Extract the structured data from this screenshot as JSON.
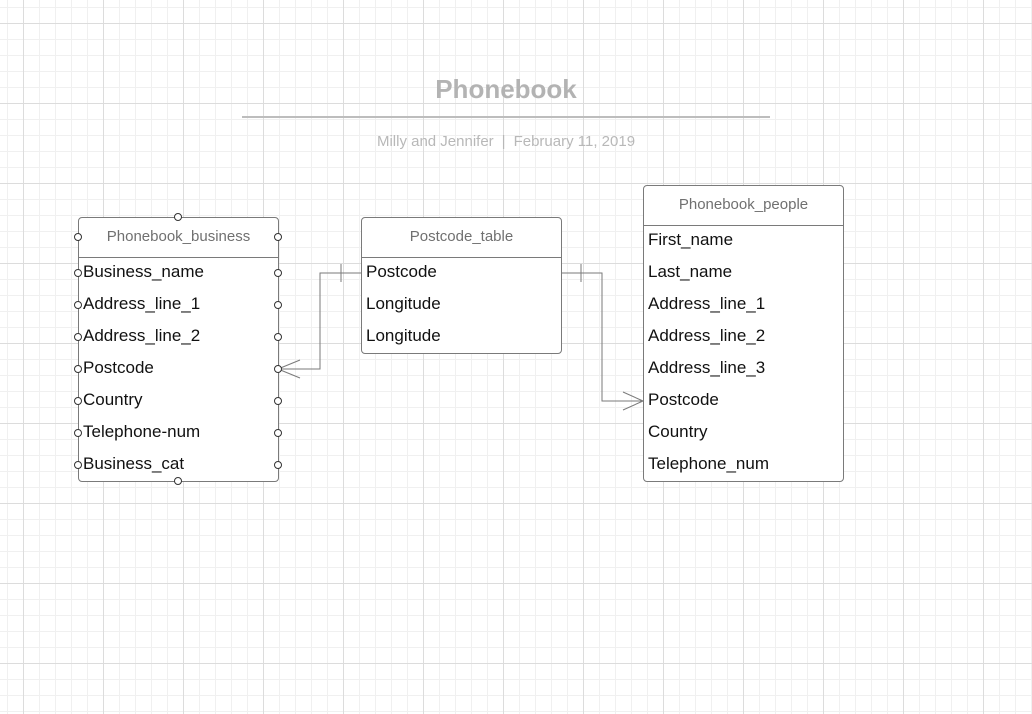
{
  "header": {
    "title": "Phonebook",
    "authors": "Milly and Jennifer",
    "separator": "|",
    "date": "February 11, 2019"
  },
  "entities": {
    "business": {
      "name": "Phonebook_business",
      "fields": [
        "Business_name",
        "Address_line_1",
        "Address_line_2",
        "Postcode",
        "Country",
        "Telephone-num",
        "Business_cat"
      ]
    },
    "postcode": {
      "name": "Postcode_table",
      "fields": [
        "Postcode",
        "Longitude",
        "Longitude"
      ]
    },
    "people": {
      "name": "Phonebook_people",
      "fields": [
        "First_name",
        "Last_name",
        "Address_line_1",
        "Address_line_2",
        "Address_line_3",
        "Postcode",
        "Country",
        "Telephone_num"
      ]
    }
  },
  "relationships": [
    {
      "from": "Postcode_table.Postcode",
      "to": "Phonebook_business.Postcode",
      "from_end": "one",
      "to_end": "many"
    },
    {
      "from": "Postcode_table.Postcode",
      "to": "Phonebook_people.Postcode",
      "from_end": "one",
      "to_end": "many"
    }
  ],
  "colors": {
    "line": "#7a7a7a",
    "title": "#b3b3b3",
    "subtitle": "#b8b8b8",
    "header_text": "#707070",
    "field_text": "#111111"
  }
}
